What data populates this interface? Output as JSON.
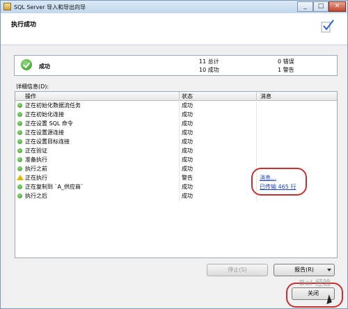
{
  "window": {
    "title": "SQL Server 导入和导出向导",
    "controls": [
      "_",
      "□",
      "✕"
    ]
  },
  "header": {
    "title": "执行成功"
  },
  "summary": {
    "status": "成功",
    "total": "11 总计",
    "success": "10 成功",
    "error": "0 错误",
    "warning": "1 警告"
  },
  "details": {
    "label": "详细信息(D):",
    "columns": [
      "操作",
      "状态",
      "消息"
    ],
    "rows": [
      {
        "action": "正在初始化数据流任务",
        "status": "成功",
        "message": "",
        "icon": "success-icon"
      },
      {
        "action": "正在初始化连接",
        "status": "成功",
        "message": "",
        "icon": "success-icon"
      },
      {
        "action": "正在设置 SQL 命令",
        "status": "成功",
        "message": "",
        "icon": "success-icon"
      },
      {
        "action": "正在设置源连接",
        "status": "成功",
        "message": "",
        "icon": "success-icon"
      },
      {
        "action": "正在设置目标连接",
        "status": "成功",
        "message": "",
        "icon": "success-icon"
      },
      {
        "action": "正在验证",
        "status": "成功",
        "message": "",
        "icon": "success-icon"
      },
      {
        "action": "准备执行",
        "status": "成功",
        "message": "",
        "icon": "success-icon"
      },
      {
        "action": "执行之前",
        "status": "成功",
        "message": "",
        "icon": "success-icon"
      },
      {
        "action": "正在执行",
        "status": "警告",
        "message": "消息...",
        "icon": "warning-icon"
      },
      {
        "action": "正在复制到 `A_供应商`",
        "status": "成功",
        "message": "已传输 465 行",
        "icon": "success-icon"
      },
      {
        "action": "执行之后",
        "status": "成功",
        "message": "",
        "icon": "success-icon"
      }
    ]
  },
  "buttons": {
    "stop": "停止(S)",
    "report": "报告(R)",
    "close": "关闭"
  },
  "watermark": "Bai 经验"
}
